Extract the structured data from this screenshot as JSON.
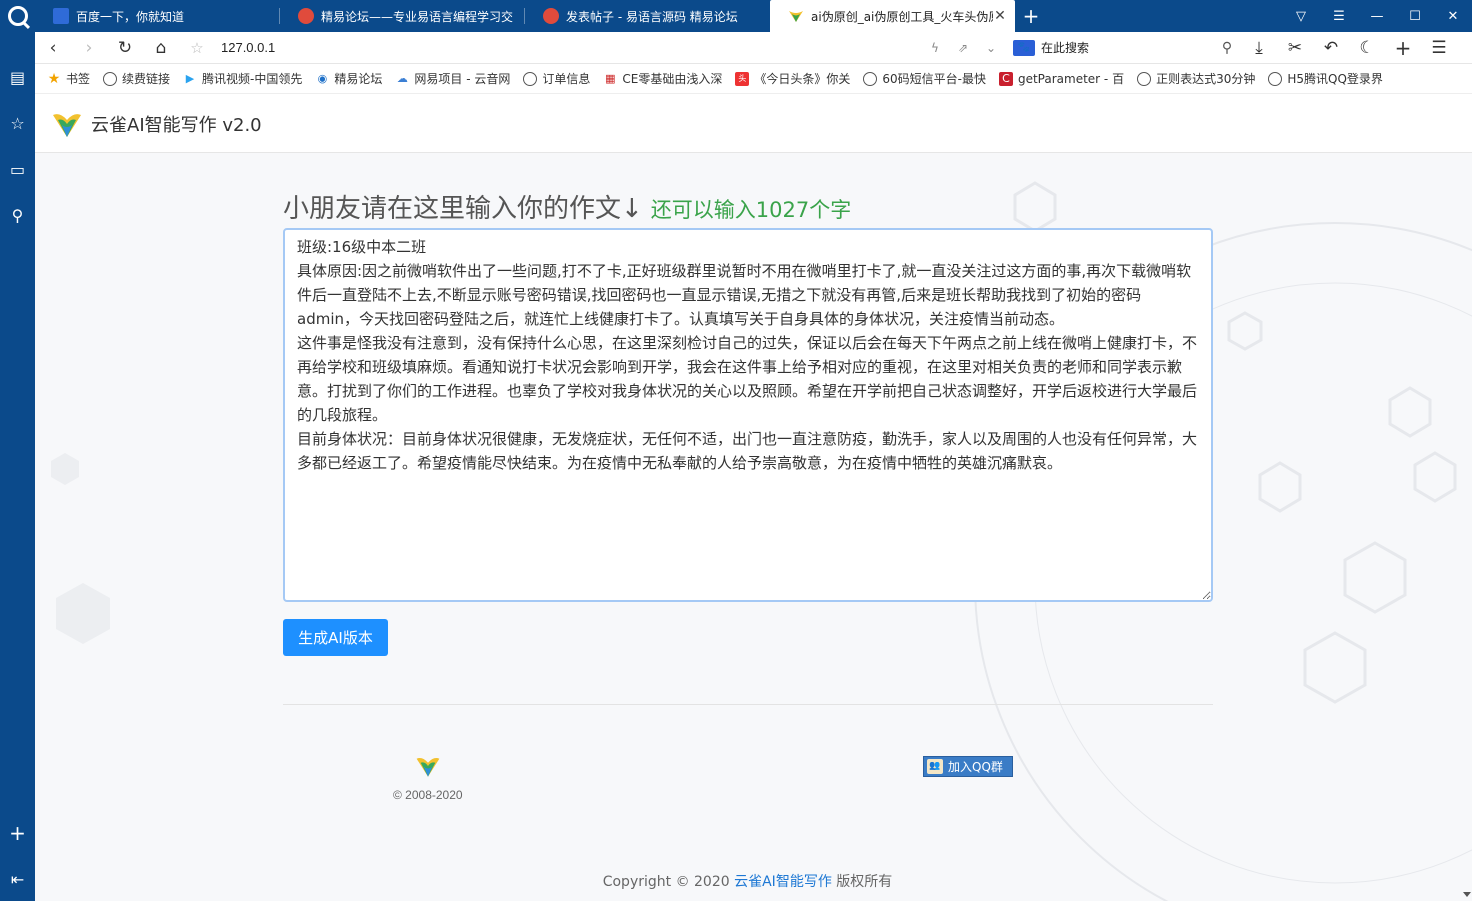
{
  "tabs": [
    {
      "label": "百度一下，你就知道",
      "favicon_color": "#2f6bd8",
      "active": false
    },
    {
      "label": "精易论坛——专业易语言编程学习交",
      "favicon_color": "#e04b3c",
      "active": false
    },
    {
      "label": "发表帖子 - 易语言源码 精易论坛",
      "favicon_color": "#e04b3c",
      "active": false
    },
    {
      "label": "ai伪原创_ai伪原创工具_火车头伪原",
      "favicon_color": "#f2c12e",
      "active": true
    }
  ],
  "toolbar": {
    "url": "127.0.0.1",
    "search_placeholder": "在此搜索",
    "search_engine_label": "🐾"
  },
  "bookmarks": [
    {
      "label": "书签",
      "icon": "star-icon"
    },
    {
      "label": "续费链接",
      "icon": "globe-icon"
    },
    {
      "label": "腾讯视频-中国领先",
      "icon": "play-icon"
    },
    {
      "label": "精易论坛",
      "icon": "eye-icon"
    },
    {
      "label": "网易项目 - 云音网",
      "icon": "cloud-icon"
    },
    {
      "label": "订单信息",
      "icon": "globe-icon"
    },
    {
      "label": "CE零基础由浅入深",
      "icon": "grid-icon"
    },
    {
      "label": "《今日头条》你关",
      "icon": "news-icon"
    },
    {
      "label": "60码短信平台-最快",
      "icon": "globe-icon"
    },
    {
      "label": "getParameter - 百",
      "icon": "c-icon"
    },
    {
      "label": "正则表达式30分钟",
      "icon": "globe-icon"
    },
    {
      "label": "H5腾讯QQ登录界",
      "icon": "globe-icon"
    }
  ],
  "site": {
    "title": "云雀AI智能写作 v2.0"
  },
  "main": {
    "prompt": "小朋友请在这里输入你的作文↓",
    "remaining": "还可以输入1027个字",
    "essay_text": "班级:16级中本二班\n具体原因:因之前微哨软件出了一些问题,打不了卡,正好班级群里说暂时不用在微哨里打卡了,就一直没关注过这方面的事,再次下载微哨软件后一直登陆不上去,不断显示账号密码错误,找回密码也一直显示错误,无措之下就没有再管,后来是班长帮助我找到了初始的密码admin，今天找回密码登陆之后，就连忙上线健康打卡了。认真填写关于自身具体的身体状况，关注疫情当前动态。\n这件事是怪我没有注意到，没有保持什么心思，在这里深刻检讨自己的过失，保证以后会在每天下午两点之前上线在微哨上健康打卡，不再给学校和班级填麻烦。看通知说打卡状况会影响到开学，我会在这件事上给予相对应的重视，在这里对相关负责的老师和同学表示歉意。打扰到了你们的工作进程。也辜负了学校对我身体状况的关心以及照顾。希望在开学前把自己状态调整好，开学后返校进行大学最后的几段旅程。\n目前身体状况：目前身体状况很健康，无发烧症状，无任何不适，出门也一直注意防疫，勤洗手，家人以及周围的人也没有任何异常，大多都已经返工了。希望疫情能尽快结束。为在疫情中无私奉献的人给予崇高敬意，为在疫情中牺牲的英雄沉痛默哀。",
    "generate_label": "生成AI版本"
  },
  "footer": {
    "years": "© 2008-2020",
    "qq_label": "加入QQ群",
    "copyright_prefix": "Copyright © 2020 ",
    "copyright_link": "云雀AI智能写作",
    "copyright_suffix": " 版权所有"
  },
  "colors": {
    "chrome_blue": "#0b4a8b",
    "accent_blue": "#1e90ff",
    "green": "#3aa34a"
  }
}
